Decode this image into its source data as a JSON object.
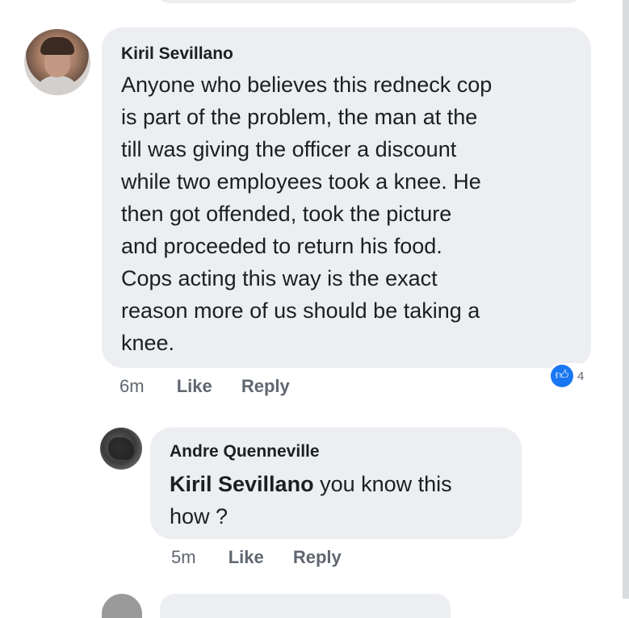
{
  "comments": [
    {
      "author": "Kiril Sevillano",
      "lines": [
        "Anyone who believes this redneck cop",
        "is part of the problem, the man at the",
        "till was giving the officer a discount",
        "while two employees took a knee. He",
        "then got offended, took the picture",
        "and proceeded to return his food.",
        "Cops acting this way is the exact",
        "reason more of us should be taking a",
        "knee."
      ],
      "time": "6m",
      "like_label": "Like",
      "reply_label": "Reply",
      "reaction": {
        "icon": "thumbs-up-icon",
        "color": "#1a77f2",
        "count": "4"
      }
    }
  ],
  "reply": {
    "author": "Andre Quenneville",
    "mention": "Kiril Sevillano",
    "line1_rest": " you know this",
    "line2": "how ?",
    "time": "5m",
    "like_label": "Like",
    "reply_label": "Reply"
  },
  "colors": {
    "bubble": "#eceef2",
    "meta_text": "#606770",
    "like_blue": "#1a77f2"
  }
}
